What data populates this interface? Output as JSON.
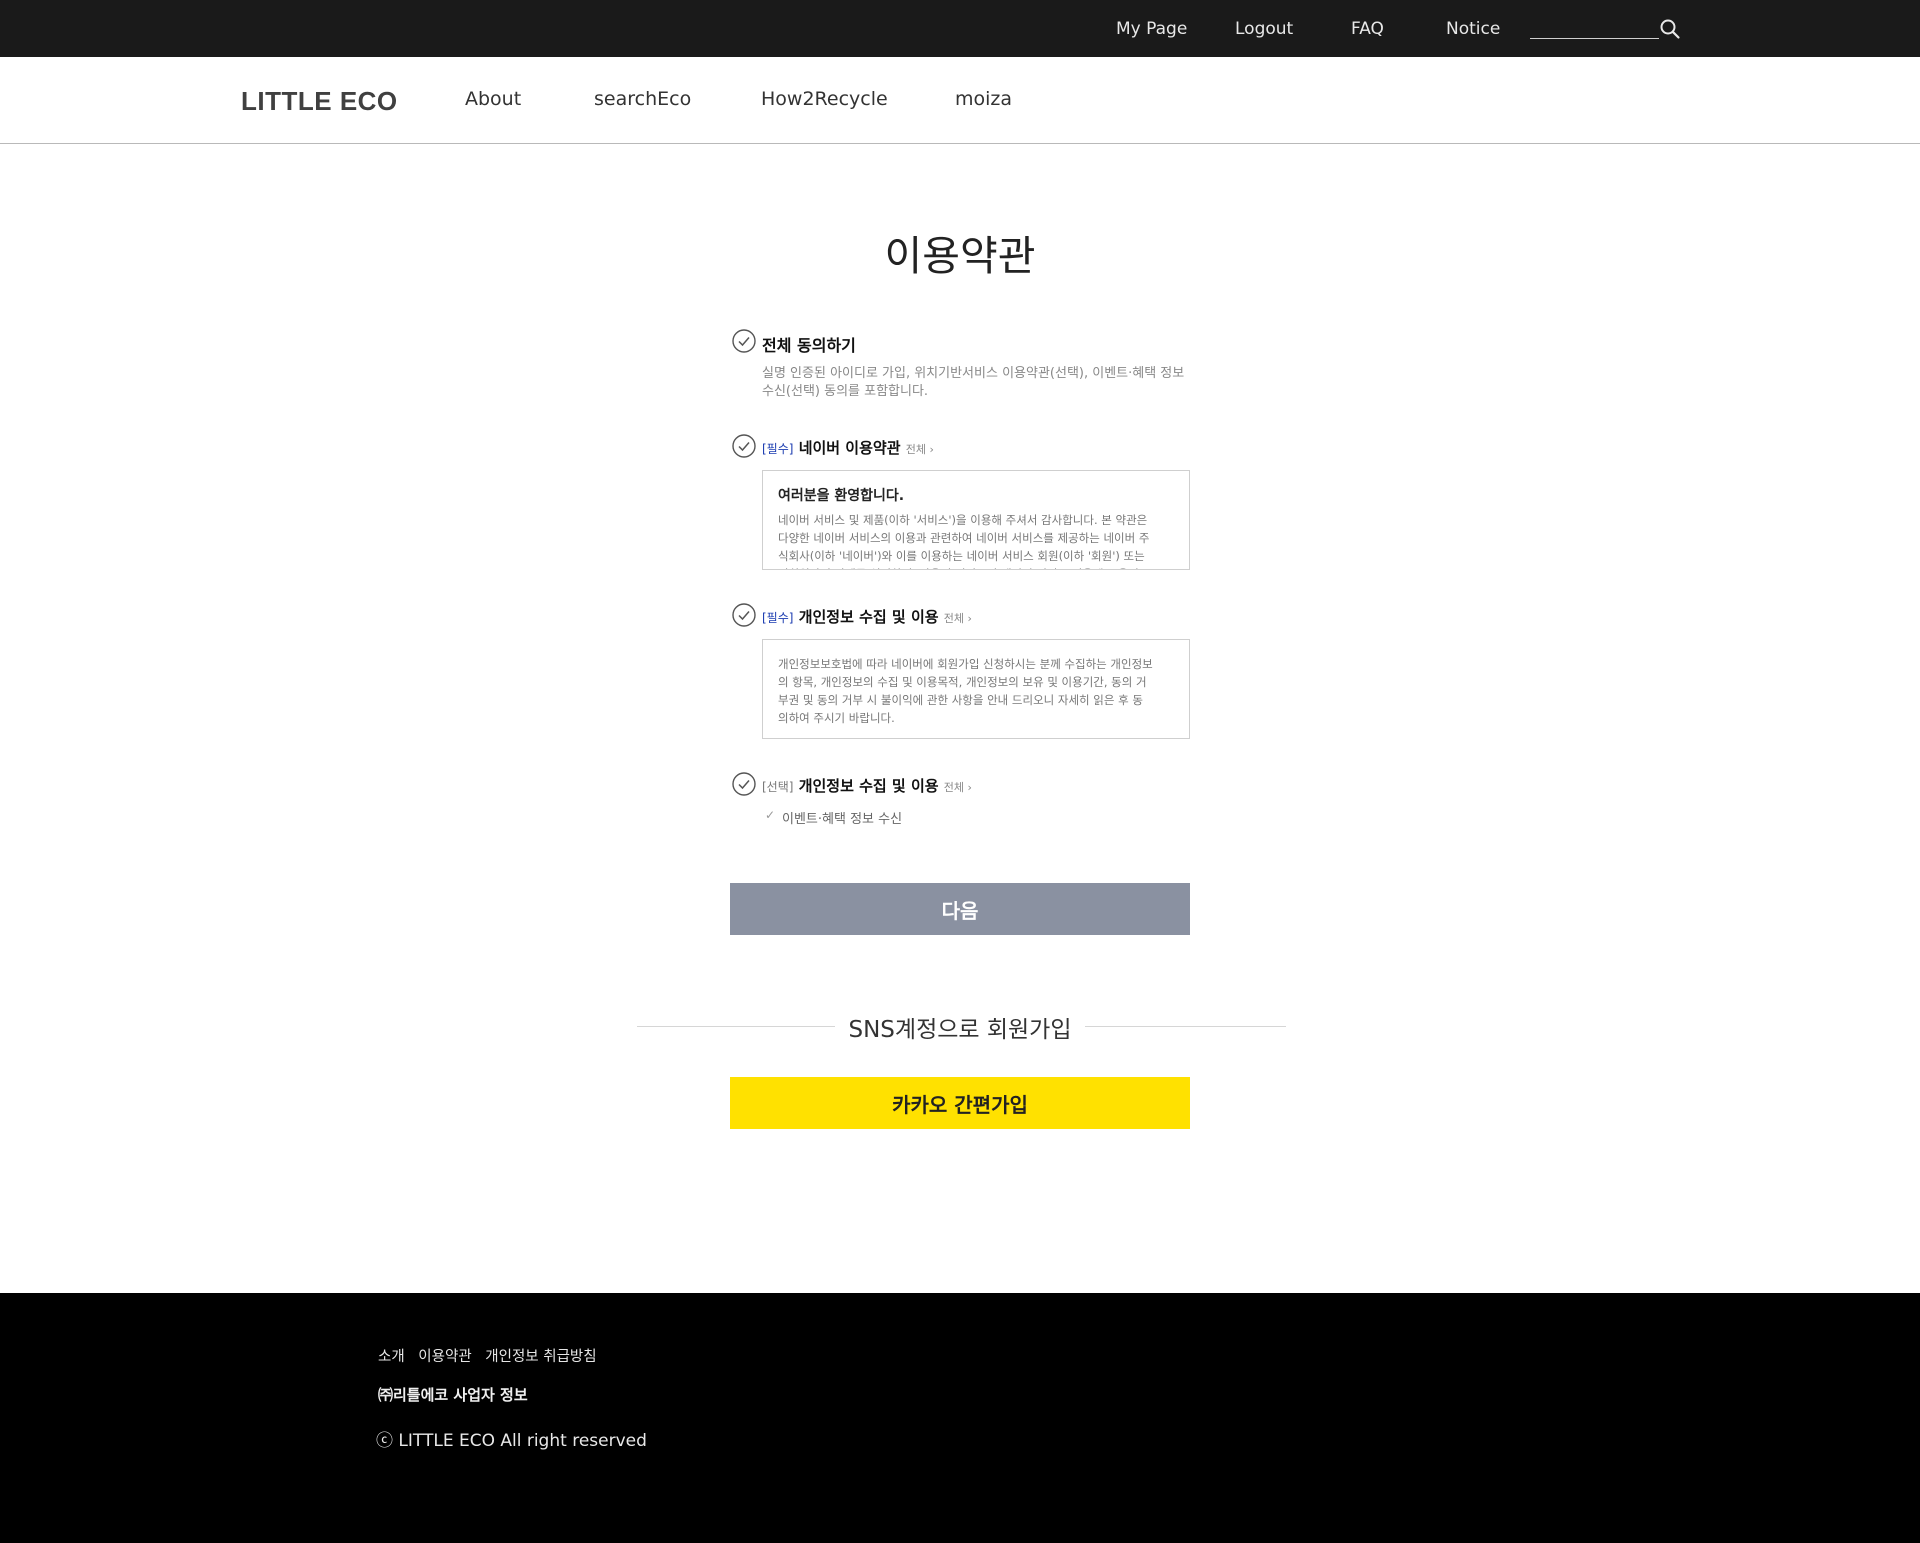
{
  "topbar": {
    "links": [
      "My Page",
      "Logout",
      "FAQ",
      "Notice"
    ],
    "search_placeholder": ""
  },
  "nav": {
    "logo": "LITTLE ECO",
    "items": [
      "About",
      "searchEco",
      "How2Recycle",
      "moiza"
    ]
  },
  "page_title": "이용약관",
  "agree_all": {
    "label": "전체 동의하기",
    "description": "실명 인증된 아이디로 가입, 위치기반서비스 이용약관(선택), 이벤트·혜택 정보 수신(선택) 동의를 포함합니다."
  },
  "terms": [
    {
      "tag": "[필수]",
      "label": "네이버 이용약관",
      "more": "전체",
      "box_heading": "여러분을 환영합니다.",
      "box_text": "네이버 서비스 및 제품(이하 '서비스')을 이용해 주셔서 감사합니다. 본 약관은 다양한 네이버 서비스의 이용과 관련하여 네이버 서비스를 제공하는 네이버 주식회사(이하 '네이버')와 이를 이용하는 네이버 서비스 회원(이하 '회원') 또는 비회원과의 관계를 설명하며, 아울러 여러분의 네이버 서비스 이용에 도움이"
    },
    {
      "tag": "[필수]",
      "label": "개인정보 수집 및 이용",
      "more": "전체",
      "box_text": "개인정보보호법에 따라 네이버에 회원가입 신청하시는 분께 수집하는 개인정보의 항목, 개인정보의 수집 및 이용목적, 개인정보의 보유 및 이용기간, 동의 거부권 및 동의 거부 시 불이익에 관한 사항을 안내 드리오니 자세히 읽은 후 동의하여 주시기 바랍니다."
    },
    {
      "tag": "[선택]",
      "label": "개인정보 수집 및 이용",
      "more": "전체",
      "sub_item": "이벤트·혜택 정보 수신"
    }
  ],
  "next_button": "다음",
  "sns_title": "SNS계정으로 회원가입",
  "kakao_button": "카카오 간편가입",
  "footer": {
    "links": [
      "소개",
      "이용약관",
      "개인정보 취급방침"
    ],
    "company": "㈜리틀에코 사업자 정보",
    "copyright": "ⓒ LITTLE ECO  All right reserved"
  },
  "colors": {
    "topbar_bg": "#1a1a1a",
    "required_tag": "#1a3bb0",
    "next_button_bg": "#8a91a1",
    "kakao_button_bg": "#ffe100",
    "footer_bg": "#000000"
  },
  "icons": [
    "search-icon",
    "check-circle-icon",
    "chevron-right-icon",
    "check-icon"
  ]
}
